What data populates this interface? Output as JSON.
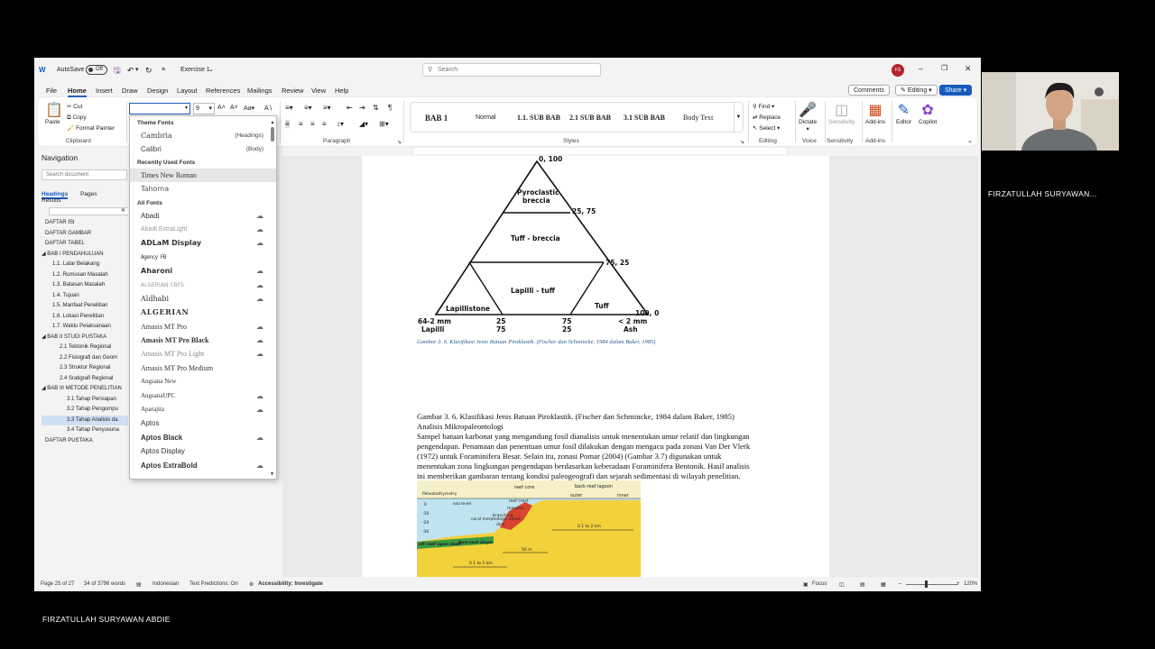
{
  "titlebar": {
    "autosave_label": "AutoSave",
    "autosave_state": "Off",
    "doc_name": "Exercise 1",
    "search_placeholder": "Search",
    "avatar_initials": "FS"
  },
  "menu": {
    "tabs": [
      "File",
      "Home",
      "Insert",
      "Draw",
      "Design",
      "Layout",
      "References",
      "Mailings",
      "Review",
      "View",
      "Help"
    ],
    "active": "Home",
    "comments": "Comments",
    "editing": "Editing",
    "share": "Share"
  },
  "ribbon": {
    "clipboard": {
      "paste": "Paste",
      "cut": "Cut",
      "copy": "Copy",
      "format_painter": "Format Painter",
      "label": "Clipboard"
    },
    "font_size": "9",
    "paragraph_label": "Paragraph",
    "styles": [
      "BAB 1",
      "Normal",
      "1.1.  SUB BAB",
      "2.1  SUB BAB",
      "3.1  SUB BAB",
      "Body Text"
    ],
    "styles_label": "Styles",
    "editing": {
      "find": "Find",
      "replace": "Replace",
      "select": "Select",
      "label": "Editing"
    },
    "voice": {
      "dictate": "Dictate",
      "label": "Voice"
    },
    "sensitivity": {
      "name": "Sensitivity",
      "label": "Sensitivity"
    },
    "addins": {
      "name": "Add-ins",
      "label": "Add-ins"
    },
    "editor": "Editor",
    "copilot": "Copilot"
  },
  "font_dropdown": {
    "theme_header": "Theme Fonts",
    "theme_fonts": [
      {
        "name": "Cambria",
        "hint": "(Headings)"
      },
      {
        "name": "Calibri",
        "hint": "(Body)"
      }
    ],
    "recent_header": "Recently Used Fonts",
    "recent_fonts": [
      "Times New Roman",
      "Tahoma"
    ],
    "all_header": "All Fonts",
    "all_fonts": [
      "Abadi",
      "Abadi ExtraLight",
      "ADLaM Display",
      "Agency FB",
      "Aharoni",
      "ALGERIAN CBFS",
      "Aldhabi",
      "ALGERIAN",
      "Amasis MT Pro",
      "Amasis MT Pro Black",
      "Amasis MT Pro Light",
      "Amasis MT Pro Medium",
      "Angsana New",
      "AngsanaUPC",
      "Aparajita",
      "Aptos",
      "Aptos Black",
      "Aptos Display",
      "Aptos ExtraBold"
    ]
  },
  "navigation": {
    "title": "Navigation",
    "search_placeholder": "Search document",
    "tabs": [
      "Headings",
      "Pages",
      "Results"
    ],
    "items": [
      {
        "text": "DAFTAR ISI",
        "level": 0
      },
      {
        "text": "DAFTAR GAMBAR",
        "level": 0
      },
      {
        "text": "DAFTAR TABEL",
        "level": 0
      },
      {
        "text": "◢ BAB I PENDAHULUAN",
        "level": -1
      },
      {
        "text": "1.1. Latar Belakang",
        "level": 1
      },
      {
        "text": "1.2. Rumusan Masalah",
        "level": 1
      },
      {
        "text": "1.3. Batasan Masalah",
        "level": 1
      },
      {
        "text": "1.4. Tujuan",
        "level": 1
      },
      {
        "text": "1.5. Manfaat Penelitian",
        "level": 1
      },
      {
        "text": "1.6. Lokasi Penelitian",
        "level": 1
      },
      {
        "text": "1.7. Waktu Pelaksanaan",
        "level": 1
      },
      {
        "text": "◢ BAB II STUDI PUSTAKA",
        "level": -1
      },
      {
        "text": "2.1 Tektonik Regional",
        "level": 2
      },
      {
        "text": "2.2 Fisiografi dan Geom",
        "level": 2
      },
      {
        "text": "2.3 Struktur Regional",
        "level": 2
      },
      {
        "text": "2.4 Sratigrafi Regional",
        "level": 2
      },
      {
        "text": "◢ BAB III METODE PENELITIAN",
        "level": -1
      },
      {
        "text": "3.1 Tahap Persiapan",
        "level": 3
      },
      {
        "text": "3.2 Tahap Pengumpu",
        "level": 3
      },
      {
        "text": "3.3 Tahap Analisis da",
        "level": 3,
        "selected": true
      },
      {
        "text": "3.4 Tahap Penyusuna",
        "level": 3
      },
      {
        "text": "DAFTAR PUSTAKA",
        "level": 0
      }
    ]
  },
  "document": {
    "triangle_labels": {
      "top": "0, 100",
      "pyroclastic": "Pyroclastic",
      "breccia": "breccia",
      "r1": "25, 75",
      "tuff_breccia": "Tuff - breccia",
      "r2": "75, 25",
      "lapilli_tuff": "Lapilli - tuff",
      "lapillistone": "Lapillistone",
      "tuff": "Tuff",
      "r3": "100, 0",
      "b1a": "64-2 mm",
      "b1b": "Lapilli",
      "b2a": "25",
      "b2b": "75",
      "b3a": "75",
      "b3b": "25",
      "b4a": "< 2 mm",
      "b4b": "Ash"
    },
    "caption": "Gambar 3. 6. Klasifikasi Jenis Batuan Piroklastik. (Fischer dan Schmincke, 1984 dalam Baker, 1985)",
    "paragraphs": [
      "Gambar 3. 6. Klasifikasi Jenis Batuan Piroklastik. (Fischer dan Schmincke, 1984 dalam Baker, 1985)",
      "Analisis Mikropaleontologi",
      "Sampel batuan karbonat yang mengandung fosil dianalisis untuk menentukan umur relatif dan lingkungan",
      "pengendapan. Penamaan dan penentuan umur fosil dilakukan dengan mengacu pada zonasi Van Der Vlerk",
      "(1972) untuk Foraminifera Besar. Selain itu, zonasi Pomar (2004) (Gambar 3.7) digunakan untuk",
      "menentukan zona lingkungan pengendapan berdasarkan keberadaan Foraminifera Bentonik. Hasil analisis",
      "ini memberikan gambaran tentang kondisi paleogeografi dan sejarah sedimentasi di wilayah penelitian."
    ],
    "reef_labels": {
      "reef_core": "reef core",
      "back_reef": "back-reef lagoon",
      "outer": "outer",
      "inner": "inner",
      "paleo": "Paleobathymetry",
      "sealevel": "sea level",
      "reef_crest": "reef crest",
      "d0": "0",
      "d10": "-10",
      "d20": "-20",
      "d30": "-30",
      "coral": "coral morphologic zones",
      "massive": "massive",
      "branching": "branching",
      "dish": "dish",
      "off_reef": "off-reef open shelf",
      "fore_reef": "fore-reef slope",
      "s1": "0.1 to 2 km",
      "s2": "50 m",
      "s3": "0.1 to 1 km"
    }
  },
  "statusbar": {
    "page": "Page 25 of 27",
    "words": "34 of 3796 words",
    "language": "Indonesian",
    "predictions": "Text Predictions: On",
    "accessibility": "Accessibility: Investigate",
    "focus": "Focus",
    "zoom": "120%"
  },
  "overlay": {
    "presenter_right": "FIRZATULLAH SURYAWAN...",
    "presenter_bottom": "FIRZATULLAH SURYAWAN ABDIE"
  },
  "colors": {
    "accent": "#185abd",
    "caption": "#2a5b8c",
    "avatar": "#b3262f"
  }
}
